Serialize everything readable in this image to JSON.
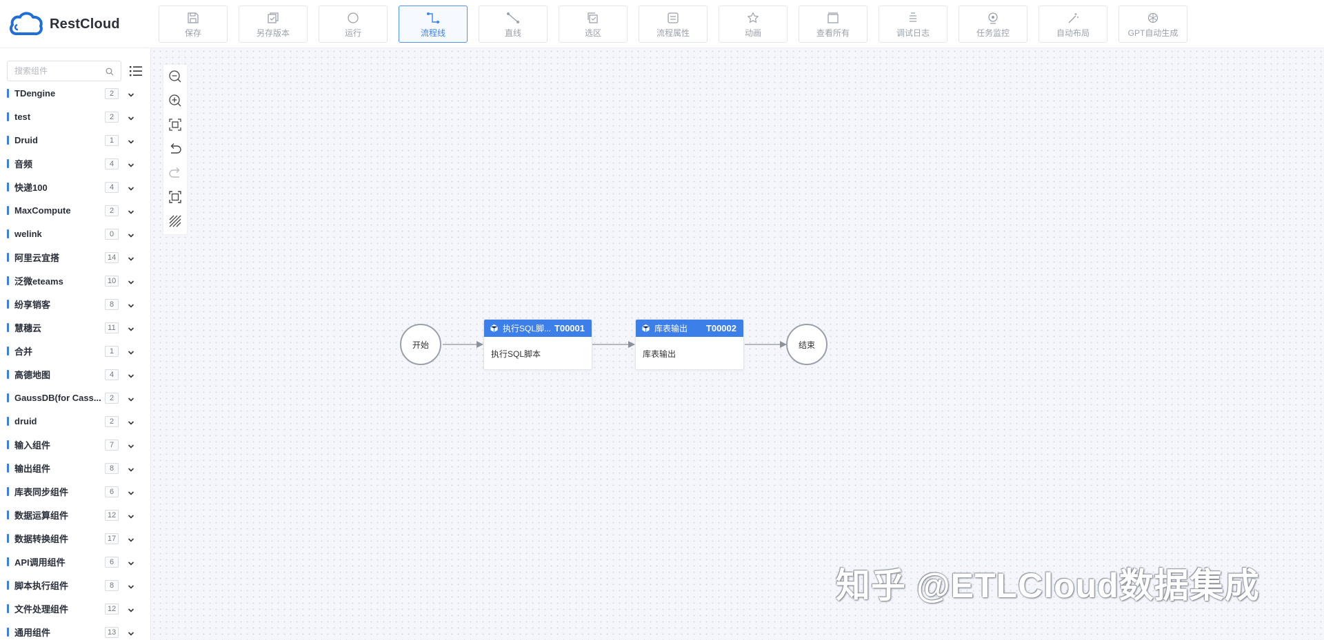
{
  "app": {
    "logo_text": "RestCloud",
    "accent_color": "#3d7fe8"
  },
  "toolbar": [
    {
      "label": "保存",
      "icon": "save-icon",
      "active": false
    },
    {
      "label": "另存版本",
      "icon": "save-version-icon",
      "active": false
    },
    {
      "label": "运行",
      "icon": "run-icon",
      "active": false
    },
    {
      "label": "流程线",
      "icon": "flow-line-icon",
      "active": true
    },
    {
      "label": "直线",
      "icon": "straight-line-icon",
      "active": false
    },
    {
      "label": "选区",
      "icon": "selection-icon",
      "active": false
    },
    {
      "label": "流程属性",
      "icon": "flow-properties-icon",
      "active": false
    },
    {
      "label": "动画",
      "icon": "animation-icon",
      "active": false
    },
    {
      "label": "查看所有",
      "icon": "view-all-icon",
      "active": false
    },
    {
      "label": "调试日志",
      "icon": "debug-log-icon",
      "active": false
    },
    {
      "label": "任务监控",
      "icon": "task-monitor-icon",
      "active": false
    },
    {
      "label": "自动布局",
      "icon": "auto-layout-icon",
      "active": false
    },
    {
      "label": "GPT自动生成",
      "icon": "gpt-generate-icon",
      "active": false
    }
  ],
  "sidebar": {
    "search_placeholder": "搜索组件",
    "categories": [
      {
        "name": "TDengine",
        "count": "2"
      },
      {
        "name": "test",
        "count": "2"
      },
      {
        "name": "Druid",
        "count": "1"
      },
      {
        "name": "音频",
        "count": "4"
      },
      {
        "name": "快递100",
        "count": "4"
      },
      {
        "name": "MaxCompute",
        "count": "2"
      },
      {
        "name": "welink",
        "count": "0"
      },
      {
        "name": "阿里云宜搭",
        "count": "14"
      },
      {
        "name": "泛微eteams",
        "count": "10"
      },
      {
        "name": "纷享销客",
        "count": "8"
      },
      {
        "name": "慧穗云",
        "count": "11"
      },
      {
        "name": "合并",
        "count": "1"
      },
      {
        "name": "高德地图",
        "count": "4"
      },
      {
        "name": "GaussDB(for Cass...",
        "count": "2"
      },
      {
        "name": "druid",
        "count": "2"
      },
      {
        "name": "输入组件",
        "count": "7"
      },
      {
        "name": "输出组件",
        "count": "8"
      },
      {
        "name": "库表同步组件",
        "count": "6"
      },
      {
        "name": "数据运算组件",
        "count": "12"
      },
      {
        "name": "数据转换组件",
        "count": "17"
      },
      {
        "name": "API调用组件",
        "count": "6"
      },
      {
        "name": "脚本执行组件",
        "count": "8"
      },
      {
        "name": "文件处理组件",
        "count": "12"
      },
      {
        "name": "通用组件",
        "count": "13"
      }
    ]
  },
  "canvas_tools": [
    "zoom-out-icon",
    "zoom-in-icon",
    "fit-view-icon",
    "undo-icon",
    "redo-icon",
    "fullscreen-icon",
    "grid-icon"
  ],
  "flow": {
    "start_label": "开始",
    "end_label": "结束",
    "tasks": [
      {
        "title": "执行SQL脚本",
        "title_short": "执行SQL脚...",
        "id": "T00001",
        "body": "执行SQL脚本"
      },
      {
        "title": "库表输出",
        "title_short": "库表输出",
        "id": "T00002",
        "body": "库表输出"
      }
    ]
  },
  "watermark": "知乎 @ETLCloud数据集成"
}
